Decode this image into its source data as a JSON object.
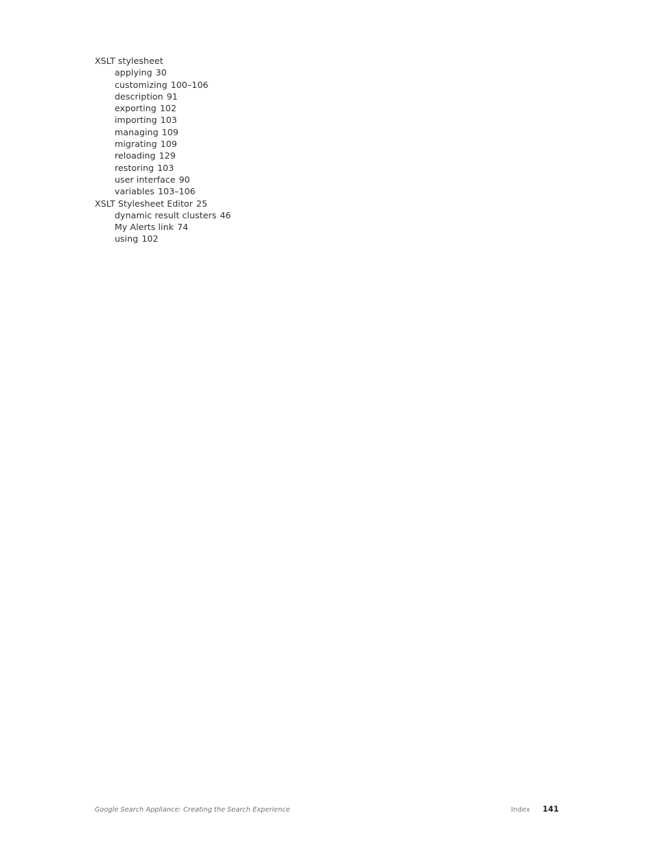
{
  "document": {
    "type": "index-page",
    "title": "Google Search Appliance: Creating the Search Experience",
    "section": "Index",
    "page_number": "141"
  },
  "index": {
    "entries": [
      {
        "level": 1,
        "term": "XSLT stylesheet",
        "pages": ""
      },
      {
        "level": 2,
        "term": "applying",
        "pages": "30"
      },
      {
        "level": 2,
        "term": "customizing",
        "pages": "100–106"
      },
      {
        "level": 2,
        "term": "description",
        "pages": "91"
      },
      {
        "level": 2,
        "term": "exporting",
        "pages": "102"
      },
      {
        "level": 2,
        "term": "importing",
        "pages": "103"
      },
      {
        "level": 2,
        "term": "managing",
        "pages": "109"
      },
      {
        "level": 2,
        "term": "migrating",
        "pages": "109"
      },
      {
        "level": 2,
        "term": "reloading",
        "pages": "129"
      },
      {
        "level": 2,
        "term": "restoring",
        "pages": "103"
      },
      {
        "level": 2,
        "term": "user interface",
        "pages": "90"
      },
      {
        "level": 2,
        "term": "variables",
        "pages": "103–106"
      },
      {
        "level": 1,
        "term": "XSLT Stylesheet Editor",
        "pages": "25"
      },
      {
        "level": 2,
        "term": "dynamic result clusters",
        "pages": "46"
      },
      {
        "level": 2,
        "term": "My Alerts link",
        "pages": "74"
      },
      {
        "level": 2,
        "term": "using",
        "pages": "102"
      }
    ]
  },
  "footer": {
    "title": "Google Search Appliance: Creating the Search Experience",
    "section": "Index",
    "page_number": "141"
  },
  "colors": {
    "background": "#ffffff",
    "body_text": "#2f2f2f",
    "footer_text": "#6f6f6f",
    "page_number": "#1d1d1d"
  }
}
